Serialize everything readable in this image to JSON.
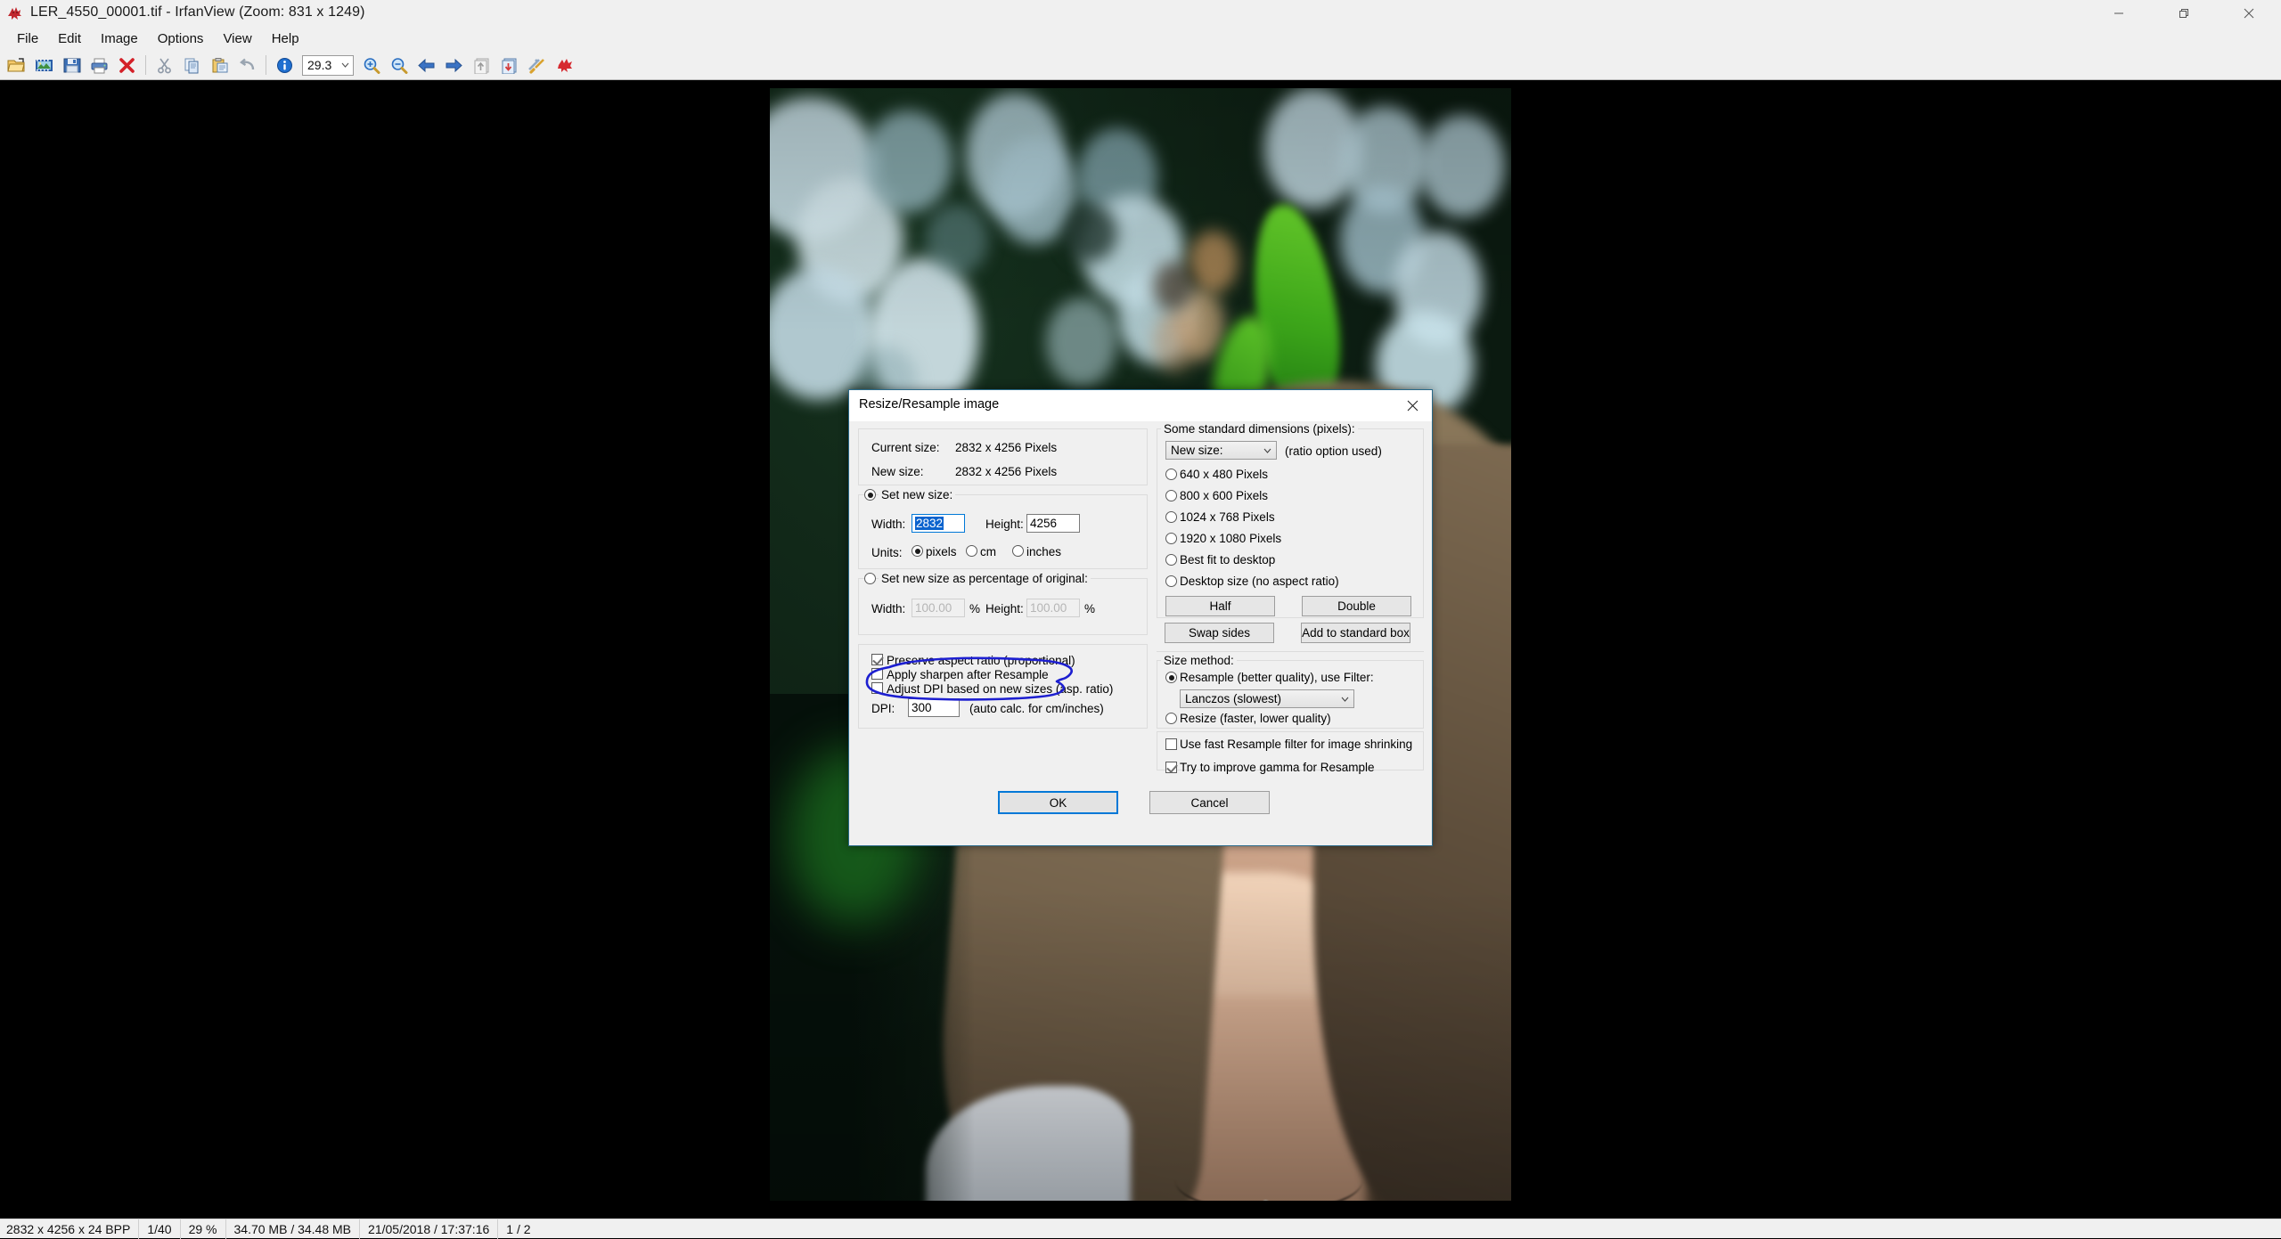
{
  "window": {
    "title": "LER_4550_00001.tif - IrfanView (Zoom: 831 x 1249)",
    "app_icon": "irfanview-cat-icon",
    "controls": {
      "minimize": "minimize-icon",
      "maximize": "maximize-icon",
      "close": "close-icon"
    }
  },
  "menubar": {
    "items": [
      "File",
      "Edit",
      "Image",
      "Options",
      "View",
      "Help"
    ]
  },
  "toolbar": {
    "zoom_value": "29.3",
    "buttons": [
      {
        "name": "open-icon"
      },
      {
        "name": "thumbnails-icon"
      },
      {
        "name": "save-icon"
      },
      {
        "name": "print-icon"
      },
      {
        "name": "delete-icon"
      },
      {
        "name": "cut-icon"
      },
      {
        "name": "copy-icon"
      },
      {
        "name": "paste-icon"
      },
      {
        "name": "undo-icon"
      },
      {
        "name": "info-icon"
      },
      {
        "name": "zoom-in-icon"
      },
      {
        "name": "zoom-out-icon"
      },
      {
        "name": "previous-icon"
      },
      {
        "name": "next-icon"
      },
      {
        "name": "first-page-icon"
      },
      {
        "name": "last-page-icon"
      },
      {
        "name": "settings-icon"
      },
      {
        "name": "effects-icon"
      }
    ]
  },
  "dialog": {
    "title": "Resize/Resample image",
    "close_icon": "close-icon",
    "current_size_label": "Current size:",
    "current_size_value": "2832  x  4256  Pixels",
    "new_size_label": "New size:",
    "new_size_value": "2832  x  4256  Pixels",
    "set_new_size": {
      "legend": "Set new size:",
      "selected": true,
      "width_label": "Width:",
      "width_value": "2832",
      "height_label": "Height:",
      "height_value": "4256",
      "units_label": "Units:",
      "units": [
        {
          "label": "pixels",
          "selected": true
        },
        {
          "label": "cm",
          "selected": false
        },
        {
          "label": "inches",
          "selected": false
        }
      ]
    },
    "set_percentage": {
      "legend": "Set new size as percentage of original:",
      "selected": false,
      "width_label": "Width:",
      "width_value": "100.00",
      "width_unit": "%",
      "height_label": "Height:",
      "height_value": "100.00",
      "height_unit": "%"
    },
    "options": [
      {
        "label": "Preserve aspect ratio (proportional)",
        "checked": true
      },
      {
        "label": "Apply sharpen after Resample",
        "checked": false
      },
      {
        "label": "Adjust DPI based on new sizes (asp. ratio)",
        "checked": false
      }
    ],
    "dpi_label": "DPI:",
    "dpi_value": "300",
    "dpi_hint": "(auto calc. for cm/inches)",
    "standard_dimensions": {
      "legend": "Some standard dimensions (pixels):",
      "combo_value": "New size:",
      "combo_hint": "(ratio option used)",
      "radios": [
        {
          "label": "640 x 480 Pixels",
          "selected": false
        },
        {
          "label": "800 x 600 Pixels",
          "selected": false
        },
        {
          "label": "1024 x 768 Pixels",
          "selected": false
        },
        {
          "label": "1920 x 1080 Pixels",
          "selected": false
        },
        {
          "label": "Best fit to desktop",
          "selected": false
        },
        {
          "label": "Desktop size (no aspect ratio)",
          "selected": false
        }
      ],
      "buttons": [
        "Half",
        "Double",
        "Swap sides",
        "Add to standard box"
      ]
    },
    "size_method": {
      "legend": "Size method:",
      "resample_label": "Resample (better quality), use Filter:",
      "resample_selected": true,
      "filter_value": "Lanczos (slowest)",
      "resize_label": "Resize (faster, lower quality)",
      "resize_selected": false,
      "checkboxes": [
        {
          "label": "Use fast Resample filter for image shrinking",
          "checked": false
        },
        {
          "label": "Try to improve gamma for Resample",
          "checked": true
        }
      ]
    },
    "ok_label": "OK",
    "cancel_label": "Cancel"
  },
  "annotation": {
    "shape": "hand-drawn-ellipse",
    "color": "#1d1fd0",
    "targets": "Apply sharpen after Resample"
  },
  "statusbar": {
    "cells": [
      "2832 x 4256 x 24 BPP",
      "1/40",
      "29 %",
      "34.70 MB / 34.48 MB",
      "21/05/2018 / 17:37:16",
      "1 / 2"
    ]
  },
  "colors": {
    "accent": "#0078d7",
    "annotation": "#1d1fd0",
    "chrome": "#f0f0f0",
    "canvas": "#000000"
  }
}
